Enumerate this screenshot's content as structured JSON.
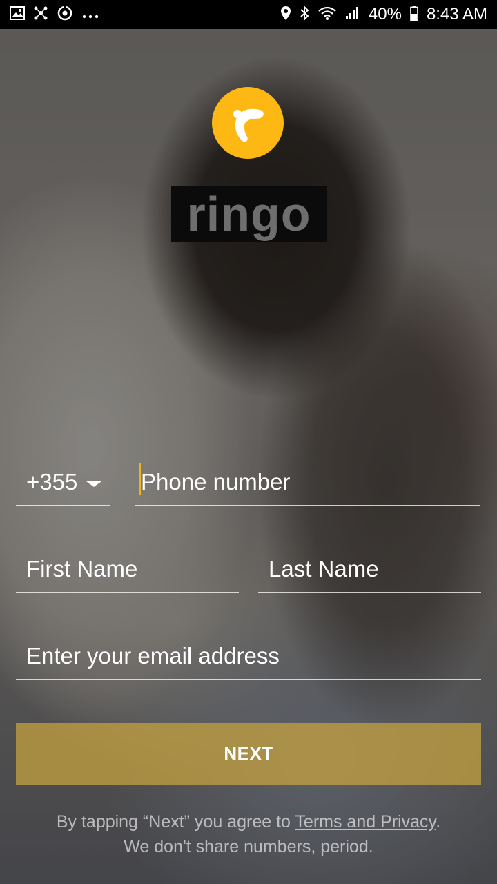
{
  "status_bar": {
    "left_icons": [
      "gallery-icon",
      "network-icon",
      "sync-icon",
      "more-icon"
    ],
    "battery": "40%",
    "time": "8:43 AM"
  },
  "brand": {
    "name": "ringo",
    "logo_color": "#fdb813"
  },
  "form": {
    "country_code": "+355",
    "phone_placeholder": "Phone number",
    "first_name_placeholder": "First Name",
    "last_name_placeholder": "Last Name",
    "email_placeholder": "Enter your email address"
  },
  "next_button": {
    "label": "NEXT",
    "color": "#c9a43e"
  },
  "terms": {
    "prefix": "By tapping “Next” you agree to ",
    "link": "Terms and Privacy",
    "suffix": ".",
    "line2": "We don't share numbers, period."
  }
}
